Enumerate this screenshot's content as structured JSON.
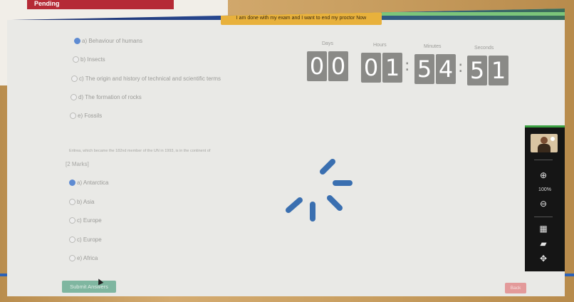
{
  "background": {
    "pending_label": "Pending"
  },
  "proctor": {
    "end_exam_label": "I am done with my exam and I want to end my proctor Now"
  },
  "question1": {
    "options": [
      {
        "label": "a) Behaviour of humans",
        "selected": true
      },
      {
        "label": "b) Insects",
        "selected": false
      },
      {
        "label": "c) The origin and history of technical and scientific terms",
        "selected": false
      },
      {
        "label": "d) The formation of rocks",
        "selected": false
      },
      {
        "label": "e) Fossils",
        "selected": false
      }
    ]
  },
  "question2": {
    "text": "Eritrea, which became the 182nd member of the UN in 1993, is in the continent of",
    "marks": "[2 Marks]",
    "options": [
      {
        "label": "a) Antarctica",
        "selected": true
      },
      {
        "label": "b) Asia",
        "selected": false
      },
      {
        "label": "c) Europe",
        "selected": false
      },
      {
        "label": "c) Europe",
        "selected": false
      },
      {
        "label": "e) Africa",
        "selected": false
      }
    ]
  },
  "timer": {
    "labels": {
      "days": "Days",
      "hours": "Hours",
      "minutes": "Minutes",
      "seconds": "Seconds"
    },
    "digits": [
      "0",
      "0",
      "0",
      "1",
      "5",
      "4",
      "5",
      "1"
    ],
    "separator": ":"
  },
  "toolbar": {
    "zoom_level": "100%",
    "icons": [
      "zoom-in-icon",
      "zoom-out-icon",
      "calculator-icon",
      "chat-icon",
      "move-icon"
    ]
  },
  "actions": {
    "submit_label": "Submit Answers",
    "back_label": "Back"
  },
  "colors": {
    "selected_radio": "#5e8bd2",
    "submit": "#7fb6a0",
    "back": "#e39a9a",
    "toolbar_bg": "#151515",
    "toolbar_accent": "#3aa041",
    "spinner": "#3a6fb0"
  }
}
